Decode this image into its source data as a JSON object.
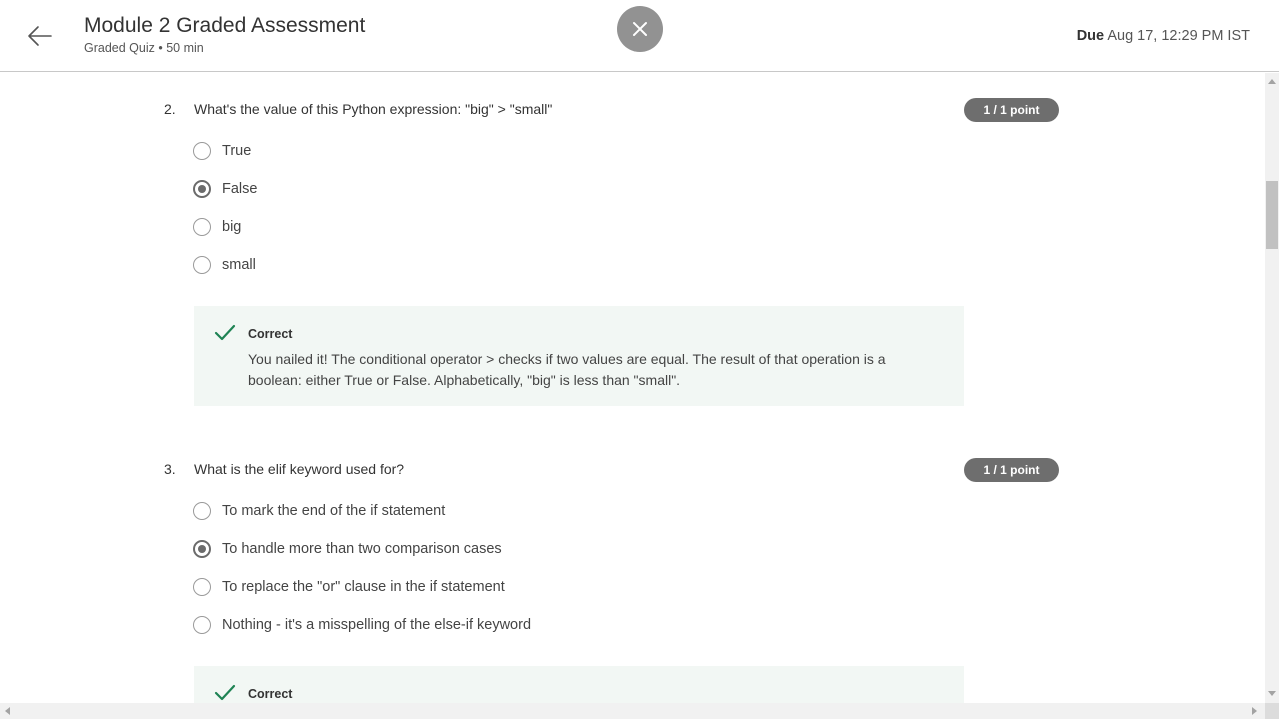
{
  "header": {
    "title": "Module 2 Graded Assessment",
    "subtitle": "Graded Quiz • 50 min",
    "due_label": "Due",
    "due_value": "Aug 17, 12:29 PM IST"
  },
  "colors": {
    "accent_green": "#1f8354",
    "feedback_bg": "#f2f7f4",
    "points_badge": "#6e6e6e",
    "close_button": "#929292"
  },
  "icons": {
    "back": "arrow-left-icon",
    "close": "close-icon",
    "correct": "checkmark-icon"
  },
  "questions": [
    {
      "number": "2.",
      "text": "What's the value of this Python expression: \"big\" > \"small\"",
      "points": "1 / 1 point",
      "selected_index": 1,
      "options": [
        "True",
        "False",
        "big",
        "small"
      ],
      "feedback": {
        "status": "Correct",
        "text": "You nailed it! The conditional operator > checks if two values are equal. The result of that operation is a boolean: either True or False. Alphabetically, \"big\" is less than \"small\"."
      }
    },
    {
      "number": "3.",
      "text": "What is the elif keyword used for?",
      "points": "1 / 1 point",
      "selected_index": 1,
      "options": [
        "To mark the end of the if statement",
        "To handle more than two comparison cases",
        "To replace the \"or\" clause in the if statement",
        "Nothing - it's a misspelling of the else-if keyword"
      ],
      "feedback": {
        "status": "Correct"
      }
    }
  ]
}
